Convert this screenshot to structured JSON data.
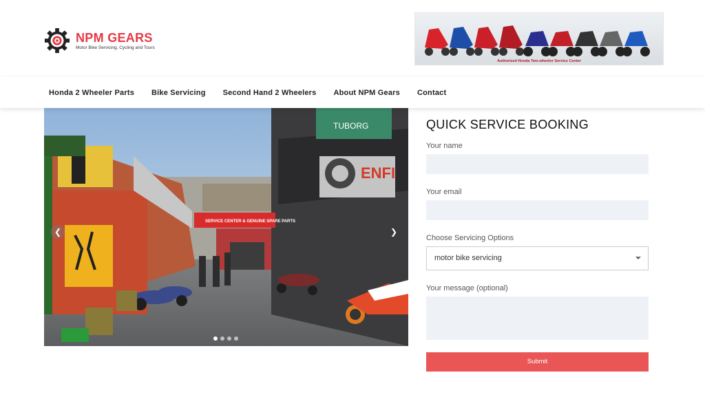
{
  "site": {
    "name": "NPM GEARS",
    "tagline": "Motor Bike Servicing, Cycling and Tours",
    "brand_color": "#e53945"
  },
  "banner": {
    "caption": "Authorized Honda Two-wheeler Service Center"
  },
  "nav": {
    "items": [
      {
        "label": "Honda 2 Wheeler Parts"
      },
      {
        "label": "Bike Servicing"
      },
      {
        "label": "Second Hand 2 Wheelers"
      },
      {
        "label": "About NPM Gears"
      },
      {
        "label": "Contact"
      }
    ]
  },
  "slider": {
    "prev_icon": "chevron-left-icon",
    "next_icon": "chevron-right-icon",
    "signs": {
      "honda": "SERVICE CENTER & GENUINE SPARE PARTS",
      "royal": "ENFI",
      "beer": "TUBORG"
    },
    "slide_count": 4,
    "active_index": 0
  },
  "booking": {
    "title": "QUICK SERVICE BOOKING",
    "name_label": "Your name",
    "email_label": "Your email",
    "service_label": "Choose Servicing Options",
    "service_value": "motor bike servicing",
    "message_label": "Your message (optional)",
    "submit_label": "Submit",
    "submit_color": "#ea5656",
    "input_bg": "#eef2f7"
  }
}
